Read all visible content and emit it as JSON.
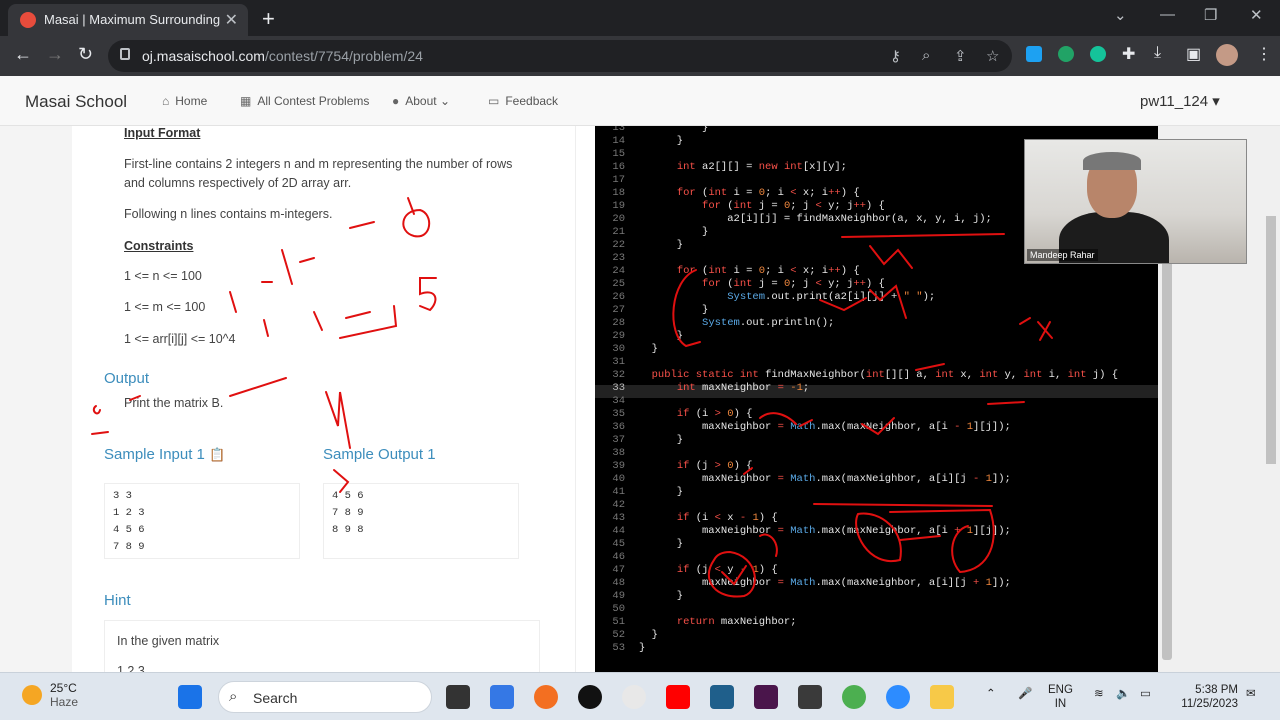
{
  "browser": {
    "tab_title": "Masai | Maximum Surrounding",
    "url_host": "oj.masaischool.com",
    "url_path": "/contest/7754/problem/24"
  },
  "site": {
    "brand": "Masai School",
    "nav": [
      "Home",
      "All Contest Problems",
      "About",
      "Feedback"
    ],
    "user": "pw11_124"
  },
  "problem": {
    "input_format_heading": "Input Format",
    "input_line1": "First-line contains 2 integers n and m representing the number of rows",
    "input_line2": "and columns respectively of 2D array arr.",
    "input_line3": "Following n lines contains m-integers.",
    "constraints_heading": "Constraints",
    "c1": "1 <= n <= 100",
    "c2": "1 <= m <= 100",
    "c3": "1 <= arr[i][j] <= 10^4",
    "output_heading": "Output",
    "output_text": "Print the matrix B.",
    "sample_input_heading": "Sample Input 1",
    "sample_output_heading": "Sample Output 1",
    "sample_input": [
      "3 3",
      "1 2 3",
      "4 5 6",
      "7 8 9"
    ],
    "sample_output": [
      "4 5 6",
      "7 8 9",
      "8 9 8"
    ],
    "hint_heading": "Hint",
    "hint_text": "In the given matrix",
    "hint_partial": "1 2 3"
  },
  "video": {
    "name": "Mandeep Rahar"
  },
  "taskbar": {
    "temp": "25°C",
    "weather": "Haze",
    "search": "Search",
    "lang1": "ENG",
    "lang2": "IN",
    "time": "5:38 PM",
    "date": "11/25/2023"
  }
}
